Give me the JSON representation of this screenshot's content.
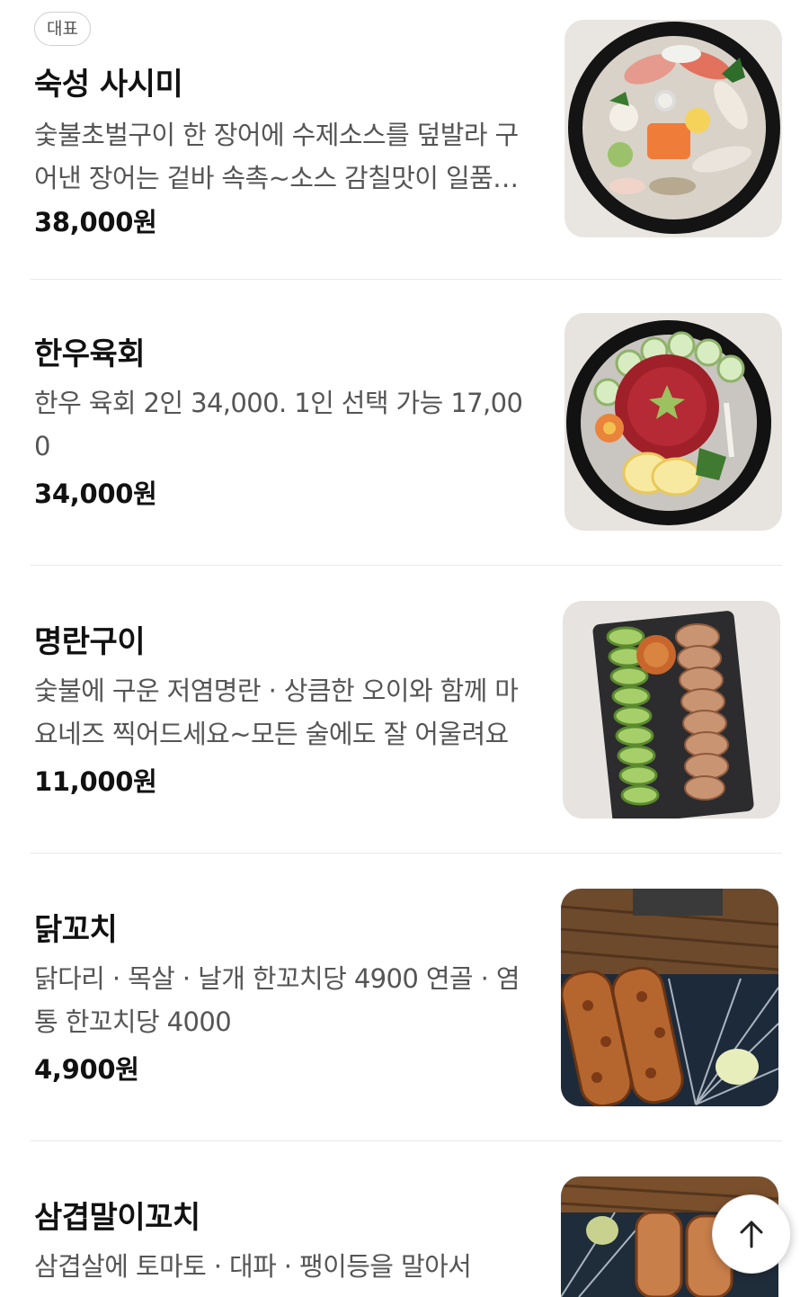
{
  "menu": {
    "items": [
      {
        "badge": "대표",
        "name": "숙성 사시미",
        "description": "숯불초벌구이 한 장어에 수제소스를 덮발라 구어낸 장어는 겉바 속촉~소스 감칠맛이 일품이에요",
        "price": "38,000원",
        "image": "sashimi-platter"
      },
      {
        "name": "한우육회",
        "description": "한우 육회 2인 34,000. 1인 선택 가능 17,000",
        "price": "34,000원",
        "image": "beef-tartare"
      },
      {
        "name": "명란구이",
        "description": "숯불에 구운 저염명란 · 상큼한 오이와 함께 마요네즈 찍어드세요~모든 술에도 잘 어울려요",
        "price": "11,000원",
        "image": "grilled-pollock-roe"
      },
      {
        "name": "닭꼬치",
        "description": "닭다리 · 목살 · 날개 한꼬치당 4900 연골 · 염통 한꼬치당 4000",
        "price": "4,900원",
        "image": "chicken-skewers"
      },
      {
        "name": "삼겹말이꼬치",
        "description": "삼겹살에 토마토 · 대파 · 팽이등을 말아서",
        "image": "pork-belly-roll-skewers"
      }
    ]
  },
  "scroll_top": {
    "icon": "arrow-up-icon"
  }
}
